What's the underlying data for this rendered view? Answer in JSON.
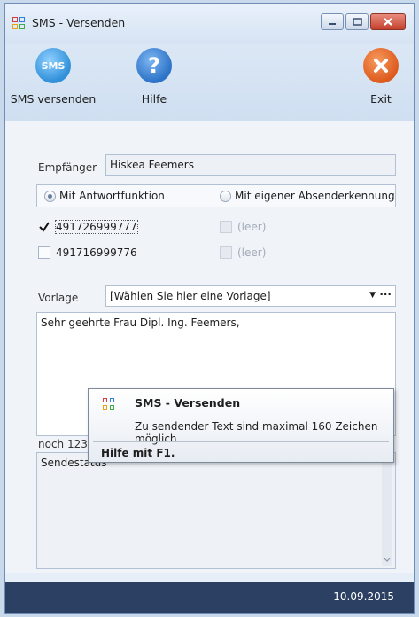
{
  "window": {
    "title": "SMS - Versenden"
  },
  "toolbar": {
    "send": {
      "label": "SMS versenden",
      "icon": "sms-icon",
      "icon_text": "SMS",
      "color": "#2f8fd8"
    },
    "help": {
      "label": "Hilfe",
      "icon": "help-icon",
      "icon_text": "?",
      "color": "#2c72c7"
    },
    "exit": {
      "label": "Exit",
      "icon": "close-icon",
      "color": "#dd5a1e"
    }
  },
  "form": {
    "recipient_label": "Empfänger",
    "recipient_value": "Hiskea Feemers",
    "radio_reply": "Mit Antwortfunktion",
    "radio_sender_id": "Mit eigener Absenderkennung",
    "radio_selected": "reply",
    "phones": [
      {
        "number": "491726999777",
        "checked": true
      },
      {
        "number": "491716999776",
        "checked": false
      }
    ],
    "empty_slots": [
      "(leer)",
      "(leer)"
    ],
    "template_label": "Vorlage",
    "template_value": "[Wählen Sie hier eine Vorlage]",
    "template_more": "···",
    "message": "Sehr geehrte Frau Dipl. Ing. Feemers,",
    "remaining_prefix": "noch 123",
    "send_status": "Sendestatus"
  },
  "tooltip": {
    "title": "SMS - Versenden",
    "text": "Zu sendender Text sind maximal 160 Zeichen möglich.",
    "help": "Hilfe mit F1."
  },
  "statusbar": {
    "date": "10.09.2015"
  },
  "colors": {
    "app_icon": [
      "#d83b3b",
      "#2f7fd8",
      "#e6a419",
      "#3fae49"
    ],
    "statusbar": "#2c4063"
  }
}
